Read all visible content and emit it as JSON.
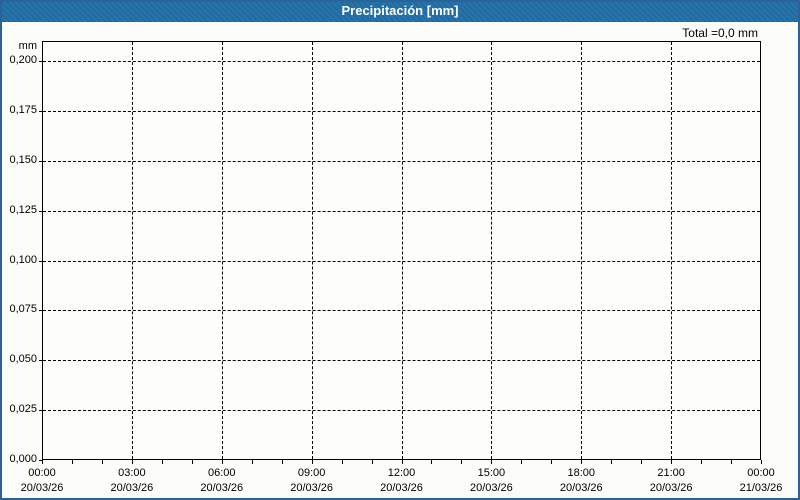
{
  "window": {
    "title": "Precipitación [mm]"
  },
  "summary": {
    "total_label": "Total =0,0 mm"
  },
  "colors": {
    "titlebar": "#1E6CA3",
    "frame_border": "#2B6399",
    "content_bg": "#FCFCFA",
    "plot_bg": "#FDFDFB",
    "grid": "#000000",
    "text": "#000000",
    "title_text": "#FFFFFF"
  },
  "chart_data": {
    "type": "bar",
    "title": "Precipitación [mm]",
    "xlabel": "",
    "ylabel": "mm",
    "ylim": [
      0,
      0.2
    ],
    "ytick_step": 0.025,
    "yticks": [
      {
        "value": 0.0,
        "label": "0,000"
      },
      {
        "value": 0.025,
        "label": "0,025"
      },
      {
        "value": 0.05,
        "label": "0,050"
      },
      {
        "value": 0.075,
        "label": "0,075"
      },
      {
        "value": 0.1,
        "label": "0,100"
      },
      {
        "value": 0.125,
        "label": "0,125"
      },
      {
        "value": 0.15,
        "label": "0,150"
      },
      {
        "value": 0.175,
        "label": "0,175"
      },
      {
        "value": 0.2,
        "label": "0,200"
      }
    ],
    "x_range_hours": [
      0,
      24
    ],
    "x_major_step_hours": 3,
    "x_minor_step_hours": 1,
    "xticks": [
      {
        "hour": 0,
        "time": "00:00",
        "date": "20/03/26"
      },
      {
        "hour": 3,
        "time": "03:00",
        "date": "20/03/26"
      },
      {
        "hour": 6,
        "time": "06:00",
        "date": "20/03/26"
      },
      {
        "hour": 9,
        "time": "09:00",
        "date": "20/03/26"
      },
      {
        "hour": 12,
        "time": "12:00",
        "date": "20/03/26"
      },
      {
        "hour": 15,
        "time": "15:00",
        "date": "20/03/26"
      },
      {
        "hour": 18,
        "time": "18:00",
        "date": "20/03/26"
      },
      {
        "hour": 21,
        "time": "21:00",
        "date": "20/03/26"
      },
      {
        "hour": 24,
        "time": "00:00",
        "date": "21/03/26"
      }
    ],
    "grid": "dashed",
    "legend": "none",
    "series": [
      {
        "name": "Precipitación",
        "values": []
      }
    ],
    "total": "0,0 mm"
  }
}
